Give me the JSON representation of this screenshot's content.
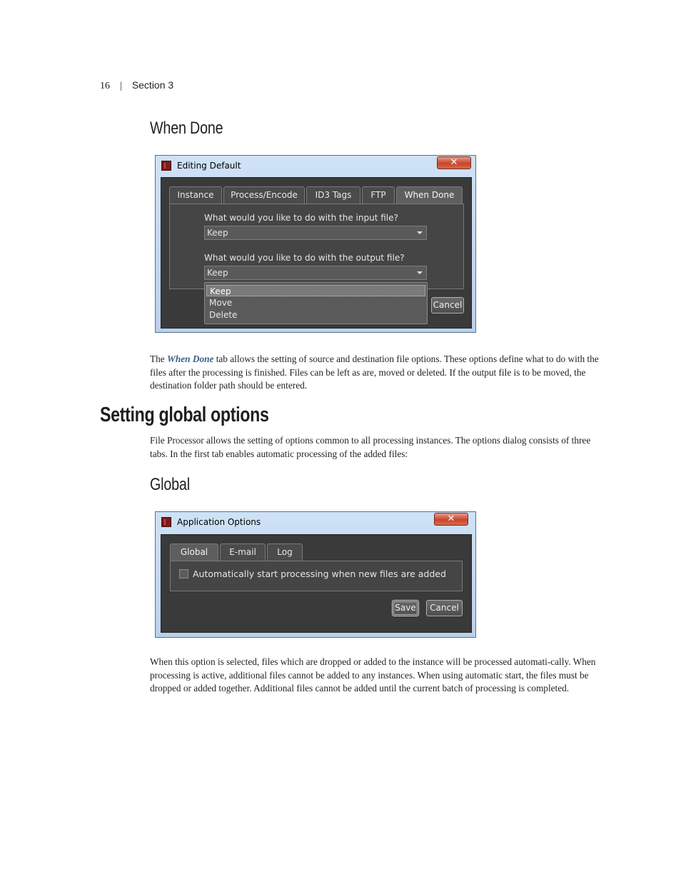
{
  "header": {
    "page_number": "16",
    "separator": "|",
    "section": "Section 3"
  },
  "when_done": {
    "heading": "When Done",
    "dialog": {
      "title": "Editing Default",
      "close_glyph": "✕",
      "tabs": [
        "Instance",
        "Process/Encode",
        "ID3 Tags",
        "FTP",
        "When Done"
      ],
      "active_tab": "When Done",
      "input_question": "What would you like to do with the input file?",
      "input_value": "Keep",
      "output_question": "What would you like to do with the output file?",
      "output_value": "Keep",
      "dropdown_options": [
        "Keep",
        "Move",
        "Delete"
      ],
      "dropdown_highlighted": "Keep",
      "cancel_label": "Cancel"
    },
    "para": {
      "before": "The ",
      "emphasis": "When Done",
      "after": " tab allows the setting of source and destination file options. These options define what to do with the files after the processing is finished.  Files can be left as are, moved or deleted. If the output file is to be moved, the destination folder path should be entered."
    }
  },
  "global_options": {
    "heading": "Setting global options",
    "intro": "File Processor allows the setting of options common to all processing instances. The options dialog consists of three tabs. In the first tab enables automatic processing of the added files:"
  },
  "global": {
    "heading": "Global",
    "dialog": {
      "title": "Application Options",
      "close_glyph": "✕",
      "tabs": [
        "Global",
        "E-mail",
        "Log"
      ],
      "active_tab": "Global",
      "checkbox_label": "Automatically start processing when new files are added",
      "checkbox_checked": false,
      "save_label": "Save",
      "cancel_label": "Cancel"
    },
    "para": "When this option is selected, files which are dropped or added to the instance will be processed automati-cally. When processing is active, additional files cannot be added to any instances. When using automatic start, the files must be dropped or added together.  Additional files cannot be added until the current batch of processing is completed."
  }
}
